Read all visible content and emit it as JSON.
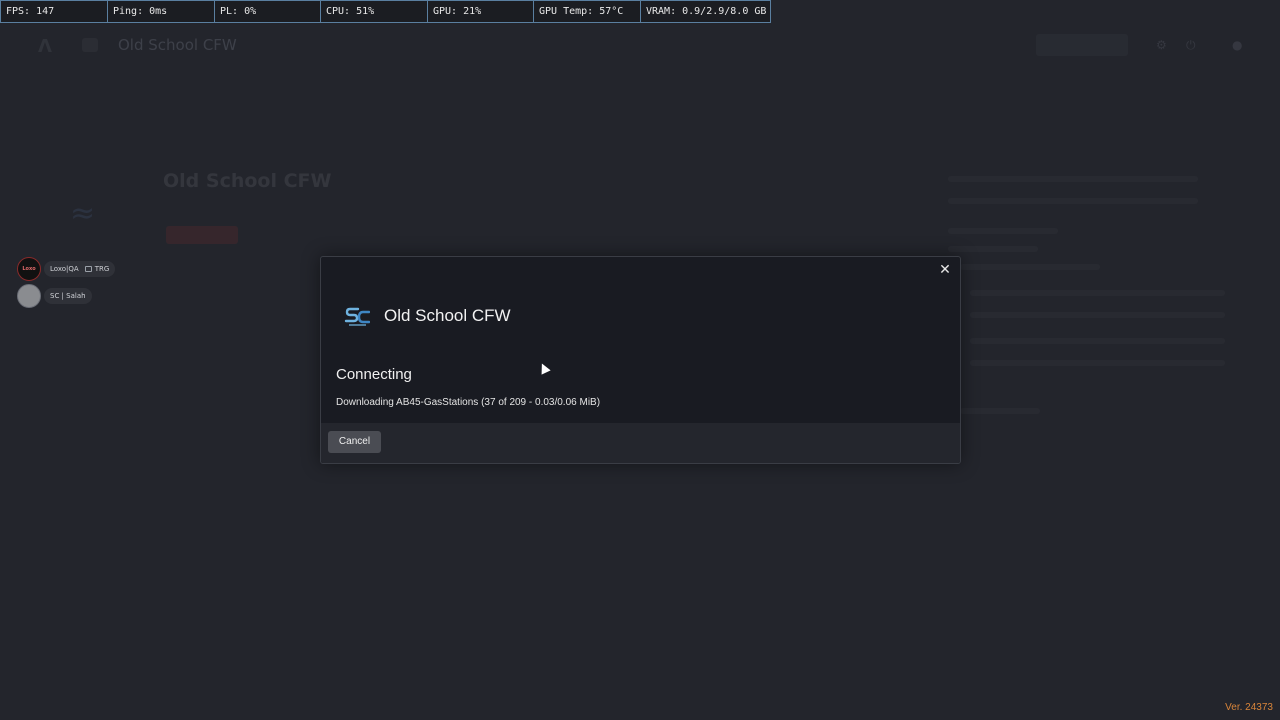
{
  "metrics": [
    "FPS: 147",
    "Ping: 0ms",
    "PL: 0%",
    "CPU: 51%",
    "GPU: 21%",
    "GPU Temp: 57°C",
    "VRAM: 0.9/2.9/8.0 GB"
  ],
  "background": {
    "title": "Old School CFW",
    "heading": "Old School CFW"
  },
  "friends": [
    {
      "name": "Loxo|QA",
      "avatar_text": "Loxo",
      "tag": "TRG"
    },
    {
      "name": "SC | Salah",
      "avatar_text": "",
      "tag": ""
    }
  ],
  "modal": {
    "server_name": "Old School CFW",
    "status": "Connecting",
    "detail": "Downloading AB45-GasStations (37 of 209 - 0.03/0.06 MiB)",
    "cancel_label": "Cancel",
    "close_glyph": "✕"
  },
  "version": "Ver. 24373",
  "colors": {
    "accent": "#d9853a",
    "modal_bg": "#191b22",
    "page_bg": "#23252c"
  }
}
